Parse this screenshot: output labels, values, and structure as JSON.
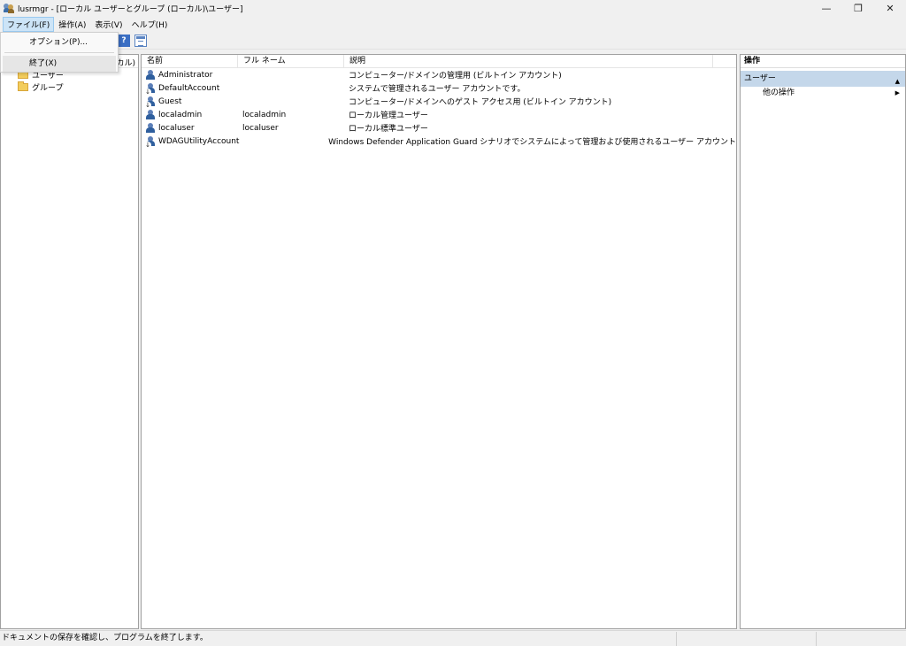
{
  "window": {
    "title": "lusrmgr - [ローカル ユーザーとグループ (ローカル)\\ユーザー]",
    "controls": {
      "minimize": "—",
      "restore": "❐",
      "close": "✕"
    }
  },
  "menubar": {
    "items": [
      {
        "label": "ファイル(F)"
      },
      {
        "label": "操作(A)"
      },
      {
        "label": "表示(V)"
      },
      {
        "label": "ヘルプ(H)"
      }
    ]
  },
  "file_menu": {
    "items": [
      {
        "label": "オプション(P)..."
      },
      {
        "label": "終了(X)"
      }
    ]
  },
  "toolbar": {
    "help_label": "?"
  },
  "tree": {
    "header_fragment": "カル)",
    "items": [
      {
        "label": "ユーザー"
      },
      {
        "label": "グループ"
      }
    ]
  },
  "list": {
    "columns": {
      "name": "名前",
      "fullname": "フル ネーム",
      "description": "説明"
    },
    "rows": [
      {
        "name": "Administrator",
        "fullname": "",
        "description": "コンピューター/ドメインの管理用 (ビルトイン アカウント)",
        "disabled": false
      },
      {
        "name": "DefaultAccount",
        "fullname": "",
        "description": "システムで管理されるユーザー アカウントです。",
        "disabled": true
      },
      {
        "name": "Guest",
        "fullname": "",
        "description": "コンピューター/ドメインへのゲスト アクセス用 (ビルトイン アカウント)",
        "disabled": true
      },
      {
        "name": "localadmin",
        "fullname": "localadmin",
        "description": "ローカル管理ユーザー",
        "disabled": false
      },
      {
        "name": "localuser",
        "fullname": "localuser",
        "description": "ローカル標準ユーザー",
        "disabled": false
      },
      {
        "name": "WDAGUtilityAccount",
        "fullname": "",
        "description": "Windows Defender Application Guard シナリオでシステムによって管理および使用されるユーザー アカウント",
        "disabled": true
      }
    ]
  },
  "actions": {
    "header": "操作",
    "section": "ユーザー",
    "item": "他の操作"
  },
  "status": {
    "text": "ドキュメントの保存を確認し、プログラムを終了します。"
  }
}
